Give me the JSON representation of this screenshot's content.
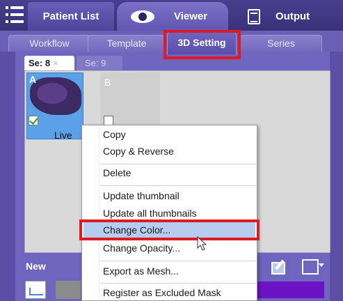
{
  "top_tabs": {
    "patient_list": "Patient List",
    "viewer": "Viewer",
    "output": "Output"
  },
  "sub_tabs": {
    "workflow": "Workflow",
    "template": "Template",
    "setting_3d": "3D Setting",
    "series": "Series"
  },
  "series_tabs": {
    "se8": "Se: 8",
    "se8_close": "×",
    "se9": "Se: 9"
  },
  "thumbnails": {
    "a_letter": "A",
    "a_label": "Live",
    "b_letter": "B"
  },
  "context_menu": {
    "copy": "Copy",
    "copy_reverse": "Copy & Reverse",
    "delete": "Delete",
    "update_thumbnail": "Update thumbnail",
    "update_all_thumbnails": "Update all thumbnails",
    "change_color": "Change Color...",
    "change_opacity": "Change Opacity...",
    "export_mesh": "Export as Mesh...",
    "register_excluded": "Register as Excluded Mask"
  },
  "bottom": {
    "new_label": "New"
  },
  "colors": {
    "accent_purple": "#5b4ea4",
    "highlight_red": "#e01a22",
    "selection_blue": "#b6cdf0",
    "mask_purple": "#6a12c4"
  },
  "icons": {
    "menu": "hamburger-list-icon",
    "viewer": "eye-icon",
    "output": "output-document-icon",
    "graph": "line-graph-icon",
    "edit": "edit-mask-icon",
    "layout": "layout-dropdown-icon",
    "cursor": "mouse-pointer-icon"
  }
}
